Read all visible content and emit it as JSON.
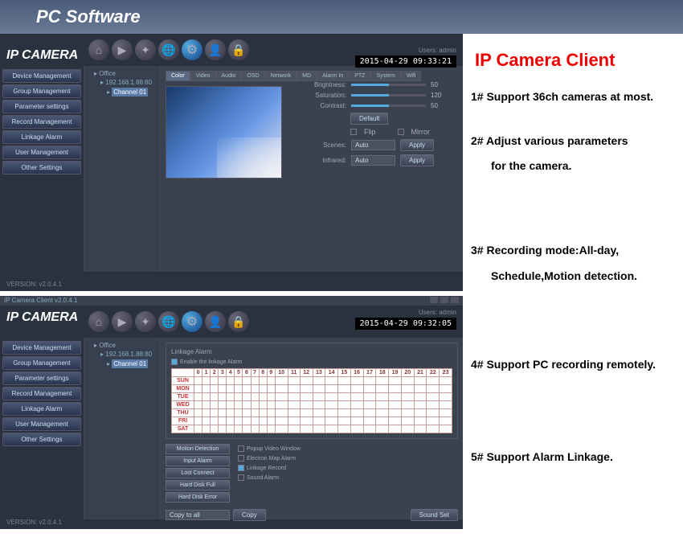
{
  "page": {
    "header": "PC Software",
    "rightTitle": "IP Camera Client"
  },
  "features": [
    "1# Support 36ch cameras at most.",
    "2# Adjust various parameters",
    "for the camera.",
    "3# Recording mode:All-day,",
    "Schedule,Motion detection.",
    "4# Support PC recording remotely.",
    "5# Support Alarm Linkage."
  ],
  "app": {
    "brand": "IP CAMERA",
    "titlebar": "IP Camera Client v2.0.4.1",
    "user": "Users: admin",
    "ts1": "2015-04-29 09:33:21",
    "ts2": "2015-04-29 09:32:05",
    "version": "VERSION: v2.0.4.1"
  },
  "sidebar": [
    "Device Management",
    "Group Management",
    "Parameter settings",
    "Record Management",
    "Linkage Alarm",
    "User Management",
    "Other Settings"
  ],
  "tree": {
    "root": "Office",
    "ip": "192.168.1.88:80",
    "ch": "Channel 01"
  },
  "tabs": [
    "Color",
    "Video",
    "Audio",
    "OSD",
    "Network",
    "MD",
    "Alarm In",
    "PTZ",
    "System",
    "Wifi"
  ],
  "colorCtrl": {
    "brightness": {
      "label": "Brightness:",
      "val": "50"
    },
    "saturation": {
      "label": "Saturation:",
      "val": "120"
    },
    "contrast": {
      "label": "Contrast:",
      "val": "50"
    },
    "default": "Default",
    "flip": "Flip",
    "mirror": "Mirror",
    "scenes": "Scenes:",
    "infrared": "Infrared:",
    "auto": "Auto",
    "apply": "Apply"
  },
  "linkage": {
    "title": "Linkage Alarm",
    "enable": "Enable the linkage Alarm",
    "hours": [
      "0",
      "1",
      "2",
      "3",
      "4",
      "5",
      "6",
      "7",
      "8",
      "9",
      "10",
      "11",
      "12",
      "13",
      "14",
      "15",
      "16",
      "17",
      "18",
      "19",
      "20",
      "21",
      "22",
      "23"
    ],
    "days": [
      "SUN",
      "MON",
      "TUE",
      "WED",
      "THU",
      "FRI",
      "SAT"
    ],
    "btns": [
      "Motion Detection",
      "Input Alarm",
      "Lost Connect",
      "Hard Disk Full",
      "Hard Disk Error"
    ],
    "opts": [
      "Popup Video Window",
      "Electron Map Alarm",
      "Linkage Record",
      "Sound Alarm"
    ],
    "copyTo": "Copy to all",
    "copy": "Copy",
    "soundSet": "Sound Set"
  }
}
